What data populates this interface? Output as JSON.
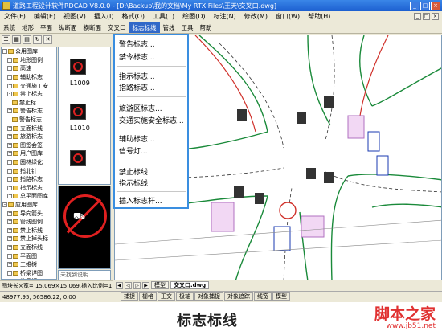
{
  "window": {
    "title": "道路工程设计软件RDCAD V8.0.0 - [D:\\Backup\\我的文档\\My RTX Files\\王天\\交叉口.dwg]",
    "buttons": [
      "_",
      "□",
      "×"
    ]
  },
  "menubar": {
    "items": [
      "文件(F)",
      "编辑(E)",
      "视图(V)",
      "插入(I)",
      "格式(O)",
      "工具(T)",
      "绘图(D)",
      "标注(N)",
      "修改(M)",
      "窗口(W)",
      "帮助(H)"
    ]
  },
  "tabbar": {
    "items": [
      "系统",
      "地形",
      "平面",
      "纵断面",
      "横断面",
      "交叉口",
      "标志标线",
      "管线",
      "工具",
      "帮助"
    ],
    "active_index": 6,
    "active_color": "#3168c8"
  },
  "tree": {
    "nodes": [
      {
        "label": "公用图库",
        "box": "-"
      },
      {
        "label": "地形图例",
        "box": "+"
      },
      {
        "label": "高速",
        "box": "+"
      },
      {
        "label": "辅助标志",
        "box": "+"
      },
      {
        "label": "交通施工安",
        "box": "+"
      },
      {
        "label": "禁止标志",
        "box": "-"
      },
      {
        "label": "禁止标",
        "box": ""
      },
      {
        "label": "警告标志",
        "box": "+"
      },
      {
        "label": "警告标志",
        "box": ""
      },
      {
        "label": "立面标线",
        "box": "+"
      },
      {
        "label": "旅游标志",
        "box": "+"
      },
      {
        "label": "图签会签",
        "box": "+"
      },
      {
        "label": "用户图库",
        "box": "+"
      },
      {
        "label": "园林绿化",
        "box": "+"
      },
      {
        "label": "指北针",
        "box": "+"
      },
      {
        "label": "指路标志",
        "box": "+"
      },
      {
        "label": "指示标志",
        "box": "+"
      },
      {
        "label": "总平面图库",
        "box": "+"
      },
      {
        "label": "应用图库",
        "box": "-"
      },
      {
        "label": "导向箭头",
        "box": "+"
      },
      {
        "label": "管线图例",
        "box": "+"
      },
      {
        "label": "禁止标线",
        "box": "+"
      },
      {
        "label": "禁止掉头标",
        "box": "+"
      },
      {
        "label": "立面标线",
        "box": "+"
      },
      {
        "label": "平面图",
        "box": "+"
      },
      {
        "label": "三维树",
        "box": "+"
      },
      {
        "label": "桥梁详图",
        "box": "+"
      },
      {
        "label": "信号灯",
        "box": "+"
      }
    ],
    "footer": "组合图库图"
  },
  "preview": {
    "thumbs": [
      "L1009",
      "L1010"
    ],
    "not_found": "未找到说明"
  },
  "dropdown": {
    "items": [
      "警告标志...",
      "禁令标志...",
      "指示标志...",
      "指路标志...",
      "旅游区标志...",
      "交通实施安全标志...",
      "辅助标志...",
      "信号灯...",
      "禁止标线",
      "指示标线",
      "插入标志杆..."
    ]
  },
  "status1": "图块长×宽= 15.069×15.069,插入比例=1",
  "drawing_tabs": {
    "items": [
      "模型",
      "交叉口.dwg"
    ]
  },
  "statusbar": {
    "coords": "48977.95, 56586.22, 0.00",
    "toggles": [
      "捕捉",
      "栅格",
      "正交",
      "极轴",
      "对象捕捉",
      "对象追踪",
      "线宽",
      "模型"
    ]
  },
  "caption": "标志标线",
  "watermark": {
    "big": "脚本之家",
    "small": "www.jb51.net"
  },
  "colors": {
    "road_green": "#1a8a3a",
    "marking_red": "#d0302a",
    "hatch_purple": "#b070c0",
    "menu_border": "#3a8ee0"
  }
}
